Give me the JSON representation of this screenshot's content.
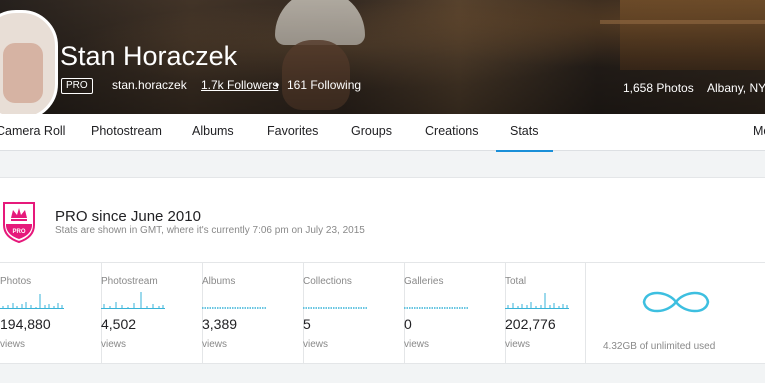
{
  "colors": {
    "accent": "#1a8fd8",
    "spark": "#37b3d8",
    "crest": "#e6197b",
    "infinity": "#3dbfe0"
  },
  "profile": {
    "name": "Stan Horaczek",
    "badge": "PRO",
    "username": "stan.horaczek",
    "followers": "1.7k Followers",
    "separator": "•",
    "following": "161 Following",
    "photos": "1,658 Photos",
    "location": "Albany, NY,"
  },
  "tabs": [
    {
      "label": "Camera Roll"
    },
    {
      "label": "Photostream"
    },
    {
      "label": "Albums"
    },
    {
      "label": "Favorites"
    },
    {
      "label": "Groups"
    },
    {
      "label": "Creations"
    },
    {
      "label": "Stats",
      "active": true
    },
    {
      "label": "Mo"
    }
  ],
  "pro": {
    "badge_text": "PRO",
    "title": "PRO since June 2010",
    "note": "Stats are shown in GMT, where it's currently 7:06 pm on July 23, 2015"
  },
  "stats": [
    {
      "label": "Photos",
      "value": "194,880",
      "unit": "views",
      "icon": "sparkline"
    },
    {
      "label": "Photostream",
      "value": "4,502",
      "unit": "views",
      "icon": "sparkline"
    },
    {
      "label": "Albums",
      "value": "3,389",
      "unit": "views",
      "icon": "flat-sparkline"
    },
    {
      "label": "Collections",
      "value": "5",
      "unit": "views",
      "icon": "flat-sparkline"
    },
    {
      "label": "Galleries",
      "value": "0",
      "unit": "views",
      "icon": "flat-sparkline"
    },
    {
      "label": "Total",
      "value": "202,776",
      "unit": "views",
      "icon": "sparkline"
    }
  ],
  "usage": {
    "text": "4.32GB of unlimited used",
    "icon": "infinity-icon"
  }
}
